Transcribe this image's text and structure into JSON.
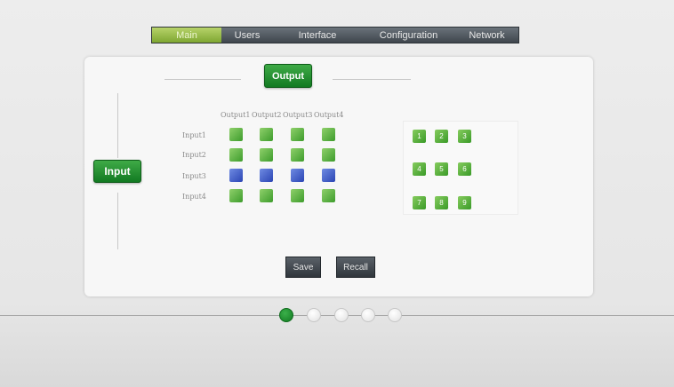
{
  "nav": {
    "tabs": [
      {
        "label": "Main",
        "active": true
      },
      {
        "label": "Users",
        "active": false
      },
      {
        "label": "Interface",
        "active": false
      },
      {
        "label": "Configuration",
        "active": false
      },
      {
        "label": "Network",
        "active": false
      }
    ]
  },
  "matrix": {
    "output_title": "Output",
    "input_title": "Input",
    "column_headers": [
      "Output1",
      "Output2",
      "Output3",
      "Output4"
    ],
    "rows": [
      {
        "label": "Input1",
        "cells": [
          "green",
          "green",
          "green",
          "green"
        ]
      },
      {
        "label": "Input2",
        "cells": [
          "green",
          "green",
          "green",
          "green"
        ]
      },
      {
        "label": "Input3",
        "cells": [
          "blue",
          "blue",
          "blue",
          "blue"
        ]
      },
      {
        "label": "Input4",
        "cells": [
          "green",
          "green",
          "green",
          "green"
        ]
      }
    ]
  },
  "presets": [
    "1",
    "2",
    "3",
    "4",
    "5",
    "6",
    "7",
    "8",
    "9"
  ],
  "actions": {
    "save_label": "Save",
    "recall_label": "Recall"
  },
  "pagination": {
    "count": 5,
    "active_index": 0
  },
  "colors": {
    "accent_green": "#127a22",
    "cell_green": "#3d9c2c",
    "cell_blue": "#2b45b4"
  }
}
